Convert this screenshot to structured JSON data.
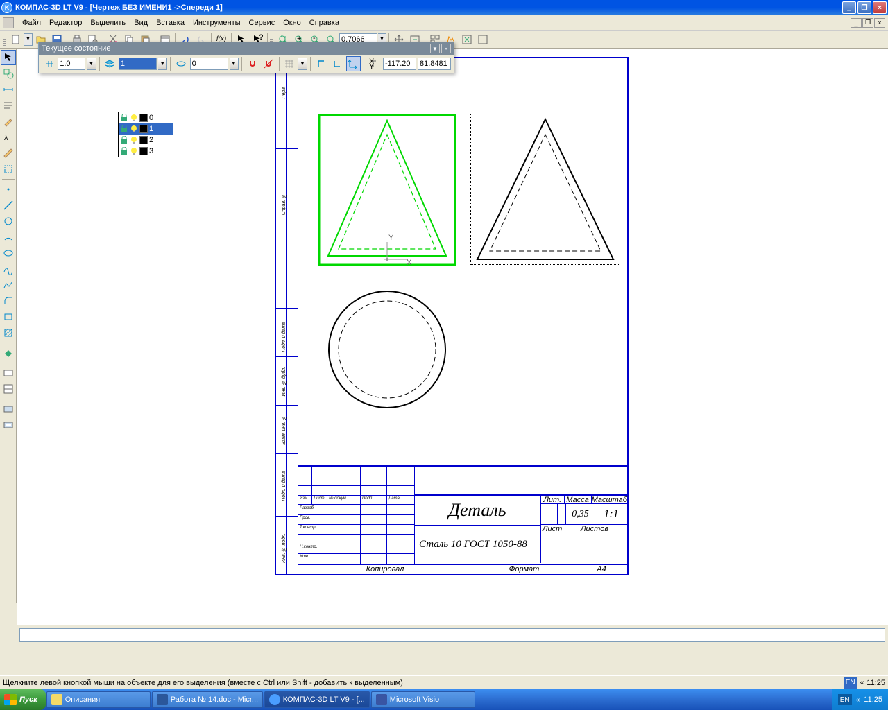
{
  "titlebar": {
    "text": "КОМПАС-3D LT V9 - [Чертеж БЕЗ ИМЕНИ1 ->Спереди 1]"
  },
  "menu": [
    "Файл",
    "Редактор",
    "Выделить",
    "Вид",
    "Вставка",
    "Инструменты",
    "Сервис",
    "Окно",
    "Справка"
  ],
  "toolbar2": {
    "zoom_value": "0.7066"
  },
  "float_state": {
    "title": "Текущее состояние",
    "step": "1.0",
    "layer_current": "1",
    "linestyle": "0",
    "x": "-117.20",
    "y": "81.8481"
  },
  "layers": [
    "0",
    "1",
    "2",
    "3"
  ],
  "title_block": {
    "detail": "Деталь",
    "material": "Сталь 10  ГОСТ 1050-88",
    "lit": "Лит.",
    "mass": "Масса",
    "scale": "Масштаб",
    "mass_val": "0,35",
    "scale_val": "1:1",
    "list": "Лист",
    "listov": "Листов",
    "kopirovol": "Копировал",
    "format": "Формат",
    "format_val": "А4",
    "rows": [
      "Изм.",
      "Лист",
      "№ докум.",
      "Подп.",
      "Дата"
    ],
    "roles": [
      "Разраб.",
      "Пров.",
      "Т.контр.",
      "",
      "Н.контр.",
      "Утв."
    ]
  },
  "status": "Щелкните левой кнопкой мыши на объекте для его выделения (вместе с Ctrl или Shift - добавить к выделенным)",
  "lang": "EN",
  "time": "11:25",
  "taskbar": {
    "start": "Пуск",
    "items": [
      "Описания",
      "Работа № 14.doc - Micr...",
      "КОМПАС-3D LT V9 - [...",
      "Microsoft Visio"
    ]
  },
  "side_labels": [
    "Перв.",
    "Справ. №",
    "Подп. и дата",
    "Инв. № дубл.",
    "Взам. инв. №",
    "Подп. и дата",
    "Инв. № подл."
  ]
}
